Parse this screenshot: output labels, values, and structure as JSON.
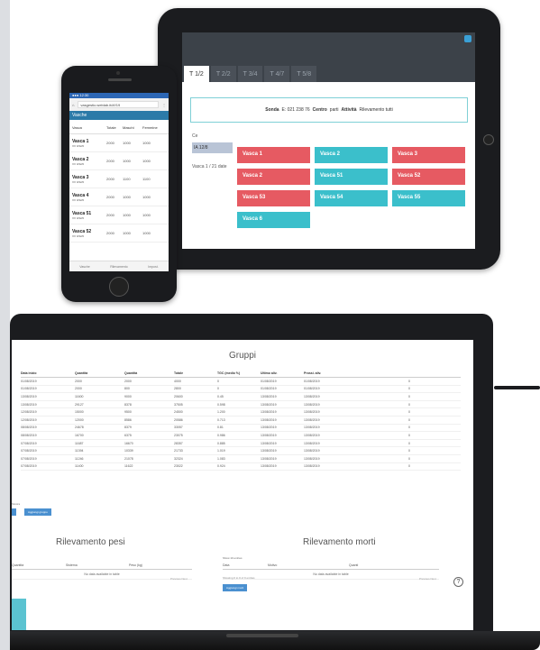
{
  "tablet": {
    "tabs": [
      "T 1/2",
      "T 2/2",
      "T 3/4",
      "T 4/7",
      "T 5/8"
    ],
    "filter": {
      "label_a": "Sonda",
      "text_a": "E: 021 238 76",
      "label_b": "Centro",
      "text_b": "parti",
      "label_c": "Attività",
      "text_c": "Rilevamento tutti"
    },
    "side": {
      "label": "Ce",
      "selected": "IA 12/8",
      "note": "Vasca 1 / 21 date"
    },
    "vasche": [
      {
        "label": "Vasca 1",
        "color": "red"
      },
      {
        "label": "Vasca 2",
        "color": "teal"
      },
      {
        "label": "Vasca 3",
        "color": "red"
      },
      {
        "label": "Vasca 2",
        "color": "red"
      },
      {
        "label": "Vasca 51",
        "color": "teal"
      },
      {
        "label": "Vasca 52",
        "color": "red"
      },
      {
        "label": "Vasca 53",
        "color": "red"
      },
      {
        "label": "Vasca 54",
        "color": "teal"
      },
      {
        "label": "Vasca 55",
        "color": "teal"
      },
      {
        "label": "Vasca 6",
        "color": "teal"
      }
    ],
    "accent_red": "#e65a62",
    "accent_teal": "#3bbfcb"
  },
  "phone": {
    "status": "●●● 12:30",
    "url": "vasgestio.weblab.it/#!/19",
    "nav": "Vasche",
    "head": [
      "Vasca",
      "Totale",
      "Maschi",
      "Femmine"
    ],
    "rows": [
      {
        "name": "Vasca 1",
        "sub": "XX 0/32/0",
        "a": "2000",
        "b": "1000",
        "c": "1000"
      },
      {
        "name": "Vasca 2",
        "sub": "XX 0/32/0",
        "a": "2000",
        "b": "1000",
        "c": "1000"
      },
      {
        "name": "Vasca 3",
        "sub": "XX 0/32/0",
        "a": "2000",
        "b": "1100",
        "c": "1100"
      },
      {
        "name": "Vasca 4",
        "sub": "XX 0/32/0",
        "a": "2000",
        "b": "1000",
        "c": "1000"
      },
      {
        "name": "Vasca 51",
        "sub": "XX 0/32/0",
        "a": "2000",
        "b": "1000",
        "c": "1000"
      },
      {
        "name": "Vasca 52",
        "sub": "XX 0/32/0",
        "a": "2000",
        "b": "1000",
        "c": "1000"
      }
    ],
    "footer": [
      "Vasche",
      "Rilevamento",
      "Impost."
    ]
  },
  "laptop": {
    "title": "Gruppi",
    "head": [
      "Data inizio",
      "Quantità",
      "Quantità",
      "Totale",
      "TGC (medio %)",
      "Ultimo aliv.",
      "Prossi. aliv.",
      "",
      ""
    ],
    "rows": [
      [
        "01/08/2019",
        "2000",
        "2000",
        "4000",
        "0",
        "01/08/2019",
        "01/08/2019",
        "",
        "0"
      ],
      [
        "01/08/2019",
        "2000",
        "800",
        "2800",
        "0",
        "01/08/2019",
        "01/08/2019",
        "",
        "0"
      ],
      [
        "13/08/2019",
        "11600",
        "9000",
        "20600",
        "0.45",
        "13/08/2019",
        "13/08/2019",
        "",
        "0"
      ],
      [
        "13/08/2019",
        "29127",
        "8378",
        "37505",
        "0.598",
        "13/08/2019",
        "13/08/2019",
        "",
        "0"
      ],
      [
        "12/08/2019",
        "15000",
        "9500",
        "24500",
        "1.200",
        "13/08/2019",
        "13/08/2019",
        "",
        "0"
      ],
      [
        "12/08/2019",
        "12000",
        "8586",
        "20586",
        "0.713",
        "13/08/2019",
        "13/08/2019",
        "",
        "0"
      ],
      [
        "08/08/2019",
        "24678",
        "8379",
        "33057",
        "0.81",
        "13/08/2019",
        "13/08/2019",
        "",
        "0"
      ],
      [
        "08/08/2019",
        "16700",
        "6375",
        "23075",
        "0.986",
        "13/08/2019",
        "13/08/2019",
        "",
        "0"
      ],
      [
        "07/08/2019",
        "11687",
        "16670",
        "28357",
        "0.885",
        "13/08/2019",
        "13/08/2019",
        "",
        "0"
      ],
      [
        "07/08/2019",
        "11394",
        "10339",
        "21733",
        "1.019",
        "13/08/2019",
        "13/08/2019",
        "",
        "0"
      ],
      [
        "07/08/2019",
        "11246",
        "21078",
        "32324",
        "1.083",
        "13/08/2019",
        "13/08/2019",
        "",
        "0"
      ],
      [
        "07/08/2019",
        "11400",
        "11622",
        "23022",
        "0.924",
        "13/08/2019",
        "13/08/2019",
        "",
        "0"
      ]
    ],
    "rows_label": "Mostra",
    "add_button": "Aggiungi gruppo",
    "pesi": {
      "title": "Rilevamento pesi",
      "head": [
        "Quantità",
        "Sistema",
        "Peso (kg)"
      ],
      "empty": "No data available in table"
    },
    "morti": {
      "title": "Rilevamento morti",
      "show": "Show 10 entries",
      "head": [
        "Data",
        "Motivo",
        "Quanti"
      ],
      "empty": "No data available in table",
      "info": "Showing 0 to 0 of 0 entries",
      "add": "Aggiungi morti"
    },
    "pager": [
      "Previous",
      "Next"
    ]
  }
}
